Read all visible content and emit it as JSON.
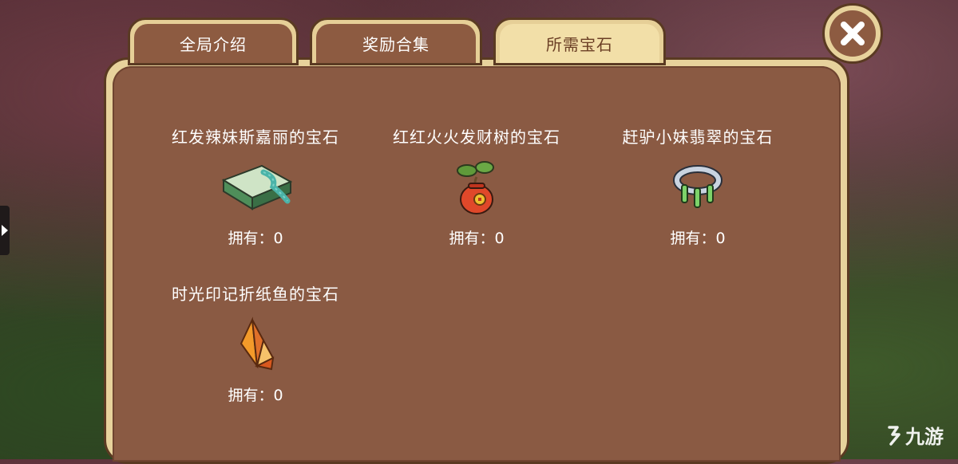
{
  "tabs": [
    {
      "label": "全局介绍",
      "active": false
    },
    {
      "label": "奖励合集",
      "active": false
    },
    {
      "label": "所需宝石",
      "active": true
    }
  ],
  "close_icon": "close-x-icon",
  "gems": [
    {
      "title": "红发辣妹斯嘉丽的宝石",
      "count_text": "拥有：0",
      "icon": "scarf-book-icon"
    },
    {
      "title": "红红火火发财树的宝石",
      "count_text": "拥有：0",
      "icon": "money-tree-pot-icon"
    },
    {
      "title": "赶驴小妹翡翠的宝石",
      "count_text": "拥有：0",
      "icon": "jade-bracelet-icon"
    },
    {
      "title": "时光印记折纸鱼的宝石",
      "count_text": "拥有：0",
      "icon": "origami-fish-icon"
    }
  ],
  "watermark": {
    "text": "九游"
  },
  "colors": {
    "panel": "#8a5a43",
    "frame": "#e7d29c",
    "active_tab": "#f2dfa8"
  }
}
